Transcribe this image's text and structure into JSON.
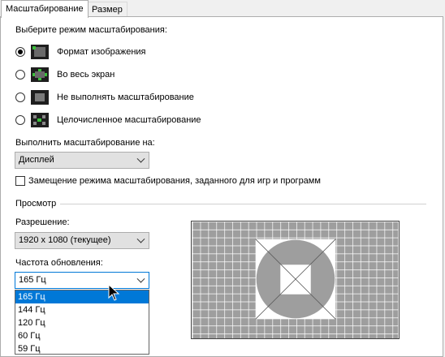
{
  "tabs": [
    {
      "label": "Масштабирование",
      "active": true
    },
    {
      "label": "Размер",
      "active": false
    }
  ],
  "scaling": {
    "heading": "Выберите режим масштабирования:",
    "options": [
      {
        "label": "Формат изображения",
        "checked": true,
        "icon": "aspect-ratio-icon"
      },
      {
        "label": "Во весь экран",
        "checked": false,
        "icon": "full-screen-icon"
      },
      {
        "label": "Не выполнять масштабирование",
        "checked": false,
        "icon": "no-scaling-icon"
      },
      {
        "label": "Целочисленное масштабирование",
        "checked": false,
        "icon": "integer-scaling-icon"
      }
    ]
  },
  "perform_on": {
    "label": "Выполнить масштабирование на:",
    "value": "Дисплей"
  },
  "override": {
    "label": "Замещение режима масштабирования, заданного для игр и программ",
    "checked": false
  },
  "preview": {
    "heading": "Просмотр",
    "resolution_label": "Разрешение:",
    "resolution_value": "1920 x 1080 (текущее)",
    "refresh_label": "Частота обновления:",
    "refresh_value": "165 Гц",
    "refresh_options": [
      "165 Гц",
      "144 Гц",
      "120 Гц",
      "60 Гц",
      "59 Гц"
    ],
    "refresh_selected_index": 0
  },
  "colors": {
    "accent": "#0078d7",
    "preview_bg": "#9e9e9e",
    "preview_grid_line": "#ffffff"
  }
}
